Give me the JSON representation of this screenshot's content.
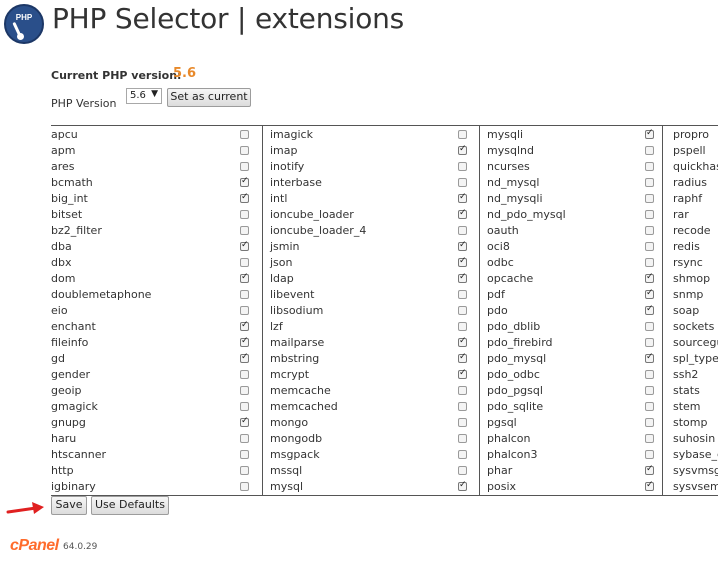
{
  "header": {
    "logo_text": "PHP",
    "title": "PHP Selector | extensions"
  },
  "current": {
    "label": "Current PHP version:",
    "value": "5.6"
  },
  "version_form": {
    "label": "PHP Version",
    "selected": "5.6",
    "set_button": "Set as current"
  },
  "extensions": [
    [
      {
        "name": "apcu",
        "checked": false
      },
      {
        "name": "apm",
        "checked": false
      },
      {
        "name": "ares",
        "checked": false
      },
      {
        "name": "bcmath",
        "checked": true
      },
      {
        "name": "big_int",
        "checked": true
      },
      {
        "name": "bitset",
        "checked": false
      },
      {
        "name": "bz2_filter",
        "checked": false
      },
      {
        "name": "dba",
        "checked": true
      },
      {
        "name": "dbx",
        "checked": false
      },
      {
        "name": "dom",
        "checked": true
      },
      {
        "name": "doublemetaphone",
        "checked": false
      },
      {
        "name": "eio",
        "checked": false
      },
      {
        "name": "enchant",
        "checked": true
      },
      {
        "name": "fileinfo",
        "checked": true
      },
      {
        "name": "gd",
        "checked": true
      },
      {
        "name": "gender",
        "checked": false
      },
      {
        "name": "geoip",
        "checked": false
      },
      {
        "name": "gmagick",
        "checked": false
      },
      {
        "name": "gnupg",
        "checked": true
      },
      {
        "name": "haru",
        "checked": false
      },
      {
        "name": "htscanner",
        "checked": false
      },
      {
        "name": "http",
        "checked": false
      },
      {
        "name": "igbinary",
        "checked": false
      }
    ],
    [
      {
        "name": "imagick",
        "checked": false
      },
      {
        "name": "imap",
        "checked": true
      },
      {
        "name": "inotify",
        "checked": false
      },
      {
        "name": "interbase",
        "checked": false
      },
      {
        "name": "intl",
        "checked": true
      },
      {
        "name": "ioncube_loader",
        "checked": true
      },
      {
        "name": "ioncube_loader_4",
        "checked": false
      },
      {
        "name": "jsmin",
        "checked": true
      },
      {
        "name": "json",
        "checked": true
      },
      {
        "name": "ldap",
        "checked": true
      },
      {
        "name": "libevent",
        "checked": false
      },
      {
        "name": "libsodium",
        "checked": false
      },
      {
        "name": "lzf",
        "checked": false
      },
      {
        "name": "mailparse",
        "checked": true
      },
      {
        "name": "mbstring",
        "checked": true
      },
      {
        "name": "mcrypt",
        "checked": true
      },
      {
        "name": "memcache",
        "checked": false
      },
      {
        "name": "memcached",
        "checked": false
      },
      {
        "name": "mongo",
        "checked": false
      },
      {
        "name": "mongodb",
        "checked": false
      },
      {
        "name": "msgpack",
        "checked": false
      },
      {
        "name": "mssql",
        "checked": false
      },
      {
        "name": "mysql",
        "checked": true
      }
    ],
    [
      {
        "name": "mysqli",
        "checked": true
      },
      {
        "name": "mysqlnd",
        "checked": false
      },
      {
        "name": "ncurses",
        "checked": false
      },
      {
        "name": "nd_mysql",
        "checked": false
      },
      {
        "name": "nd_mysqli",
        "checked": false
      },
      {
        "name": "nd_pdo_mysql",
        "checked": false
      },
      {
        "name": "oauth",
        "checked": false
      },
      {
        "name": "oci8",
        "checked": false
      },
      {
        "name": "odbc",
        "checked": false
      },
      {
        "name": "opcache",
        "checked": true
      },
      {
        "name": "pdf",
        "checked": true
      },
      {
        "name": "pdo",
        "checked": true
      },
      {
        "name": "pdo_dblib",
        "checked": false
      },
      {
        "name": "pdo_firebird",
        "checked": false
      },
      {
        "name": "pdo_mysql",
        "checked": true
      },
      {
        "name": "pdo_odbc",
        "checked": false
      },
      {
        "name": "pdo_pgsql",
        "checked": false
      },
      {
        "name": "pdo_sqlite",
        "checked": false
      },
      {
        "name": "pgsql",
        "checked": false
      },
      {
        "name": "phalcon",
        "checked": false
      },
      {
        "name": "phalcon3",
        "checked": false
      },
      {
        "name": "phar",
        "checked": true
      },
      {
        "name": "posix",
        "checked": true
      }
    ],
    [
      {
        "name": "propro"
      },
      {
        "name": "pspell"
      },
      {
        "name": "quickhas"
      },
      {
        "name": "radius"
      },
      {
        "name": "raphf"
      },
      {
        "name": "rar"
      },
      {
        "name": "recode"
      },
      {
        "name": "redis"
      },
      {
        "name": "rsync"
      },
      {
        "name": "shmop"
      },
      {
        "name": "snmp"
      },
      {
        "name": "soap"
      },
      {
        "name": "sockets"
      },
      {
        "name": "sourcegu"
      },
      {
        "name": "spl_types"
      },
      {
        "name": "ssh2"
      },
      {
        "name": "stats"
      },
      {
        "name": "stem"
      },
      {
        "name": "stomp"
      },
      {
        "name": "suhosin"
      },
      {
        "name": "sybase_c"
      },
      {
        "name": "sysvmsg"
      },
      {
        "name": "sysvsem"
      }
    ]
  ],
  "actions": {
    "save": "Save",
    "defaults": "Use Defaults"
  },
  "footer": {
    "brand": "cPanel",
    "version": "64.0.29"
  },
  "colors": {
    "accent_version": "#e8892a",
    "cpanel_brand": "#ff6c2c",
    "arrow": "#e02020"
  }
}
